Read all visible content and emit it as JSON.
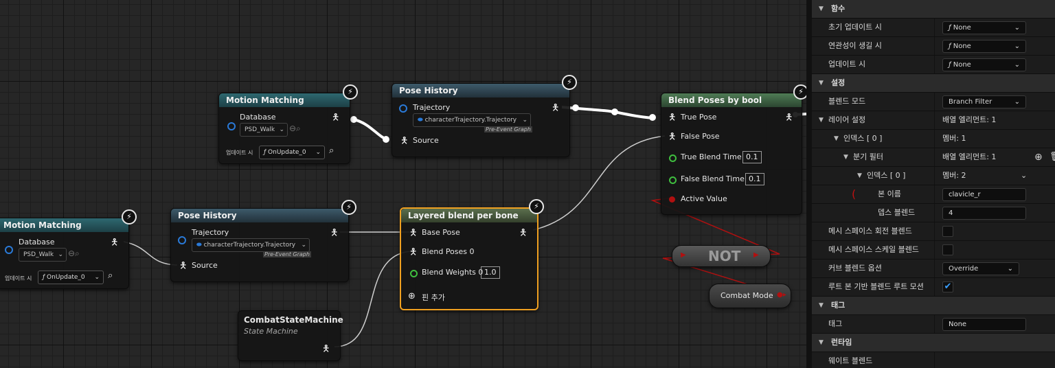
{
  "graph": {
    "mm_top": {
      "title": "Motion Matching",
      "pin_label": "Database",
      "db_value": "PSD_Walk",
      "update_label": "업데이트 시",
      "func_value": "OnUpdate_0"
    },
    "mm_left": {
      "title": "Motion Matching",
      "pin_label": "Database",
      "db_value": "PSD_Walk",
      "update_label": "업데이트 시",
      "func_value": "OnUpdate_0"
    },
    "ph_top": {
      "title": "Pose History",
      "traj_label": "Trajectory",
      "traj_value": "characterTrajectory.Trajectory",
      "pre_event": "Pre-Event Graph",
      "source_label": "Source"
    },
    "ph_mid": {
      "title": "Pose History",
      "traj_label": "Trajectory",
      "traj_value": "characterTrajectory.Trajectory",
      "pre_event": "Pre-Event Graph",
      "source_label": "Source"
    },
    "lbpb": {
      "title": "Layered blend per bone",
      "base_pose": "Base Pose",
      "blend_poses": "Blend Poses 0",
      "blend_weights": "Blend Weights 0",
      "weight_value": "1.0",
      "add_pin": "핀 추가"
    },
    "bpb": {
      "title": "Blend Poses by bool",
      "true_pose": "True Pose",
      "false_pose": "False Pose",
      "true_blend_time": "True Blend Time",
      "true_blend_value": "0.1",
      "false_blend_time": "False Blend Time",
      "false_blend_value": "0.1",
      "active_value": "Active Value"
    },
    "csm": {
      "title": "CombatStateMachine",
      "subtitle": "State Machine"
    },
    "not_node": {
      "label": "NOT"
    },
    "combat_mode": {
      "label": "Combat Mode"
    }
  },
  "details": {
    "sections": {
      "functions": "함수",
      "settings": "설정",
      "tags": "태그",
      "runtime": "런타임"
    },
    "rows": {
      "initial_update": "초기 업데이트 시",
      "becoming_relevant": "연관성이 생길 시",
      "on_update": "업데이트 시",
      "blend_mode": "블렌드 모드",
      "layer_setup": "레이어 설정",
      "index0": "인덱스 [ 0 ]",
      "branch_filter": "분기 필터",
      "index0_inner": "인덱스 [ 0 ]",
      "bone_name": "본 이름",
      "blend_depth": "뎁스 블렌드",
      "mesh_rot": "메시 스페이스 회전 블렌드",
      "mesh_scale": "메시 스페이스 스케일 블렌드",
      "curve_blend": "커브 블렌드 옵션",
      "root_motion": "루트 본 기반 블렌드 루트 모션",
      "tag": "태그",
      "weight_blend": "웨이트 블렌드"
    },
    "values": {
      "none": "None",
      "branch_filter_mode": "Branch Filter",
      "array_elements_1": "배열 엘리먼트: 1",
      "members_1": "멤버: 1",
      "array_elements_1b": "배열 엘리먼트: 1",
      "members_2": "멤버: 2",
      "bone_name_value": "clavicle_r",
      "blend_depth_value": "4",
      "curve_blend_value": "Override",
      "tag_value": "None"
    },
    "func_icon": "ƒ"
  },
  "icons": {
    "bolt": "lightning-bolt-icon",
    "pose": "person-pose-icon",
    "search": "magnifier-icon",
    "chevron": "chevron-down-icon",
    "add": "plus-circle-icon",
    "trash": "trash-icon",
    "check": "checkmark-icon"
  }
}
